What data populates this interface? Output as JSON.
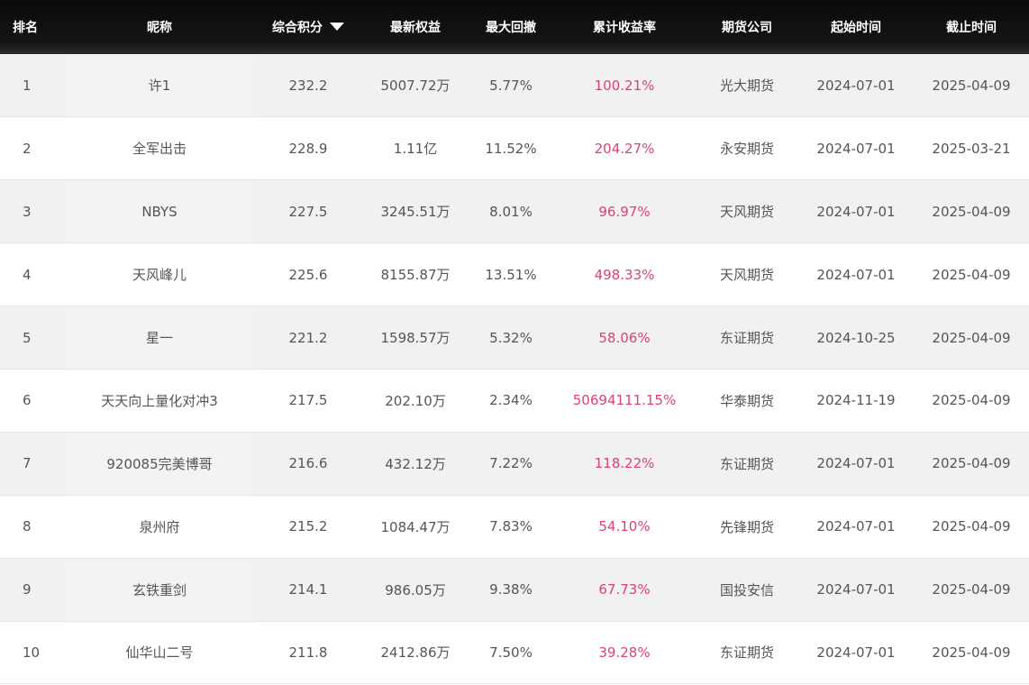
{
  "table": {
    "headers": {
      "rank": "排名",
      "name": "昵称",
      "score": "综合积分",
      "equity": "最新权益",
      "drawdown": "最大回撤",
      "return": "累计收益率",
      "broker": "期货公司",
      "start": "起始时间",
      "end": "截止时间"
    },
    "sort": {
      "column": "score",
      "direction": "desc",
      "icon": "triangle-down-icon"
    },
    "colors": {
      "header_bg": "#111111",
      "return_text": "#dd3f7c",
      "stripe": "#f1f1f1"
    },
    "rows": [
      {
        "rank": "1",
        "name": "许1",
        "score": "232.2",
        "equity": "5007.72万",
        "drawdown": "5.77%",
        "return": "100.21%",
        "broker": "光大期货",
        "start": "2024-07-01",
        "end": "2025-04-09"
      },
      {
        "rank": "2",
        "name": "全军出击",
        "score": "228.9",
        "equity": "1.11亿",
        "drawdown": "11.52%",
        "return": "204.27%",
        "broker": "永安期货",
        "start": "2024-07-01",
        "end": "2025-03-21"
      },
      {
        "rank": "3",
        "name": "NBYS",
        "score": "227.5",
        "equity": "3245.51万",
        "drawdown": "8.01%",
        "return": "96.97%",
        "broker": "天风期货",
        "start": "2024-07-01",
        "end": "2025-04-09"
      },
      {
        "rank": "4",
        "name": "天风峰儿",
        "score": "225.6",
        "equity": "8155.87万",
        "drawdown": "13.51%",
        "return": "498.33%",
        "broker": "天风期货",
        "start": "2024-07-01",
        "end": "2025-04-09"
      },
      {
        "rank": "5",
        "name": "星一",
        "score": "221.2",
        "equity": "1598.57万",
        "drawdown": "5.32%",
        "return": "58.06%",
        "broker": "东证期货",
        "start": "2024-10-25",
        "end": "2025-04-09"
      },
      {
        "rank": "6",
        "name": "天天向上量化对冲3",
        "score": "217.5",
        "equity": "202.10万",
        "drawdown": "2.34%",
        "return": "50694111.15%",
        "broker": "华泰期货",
        "start": "2024-11-19",
        "end": "2025-04-09"
      },
      {
        "rank": "7",
        "name": "920085完美博哥",
        "score": "216.6",
        "equity": "432.12万",
        "drawdown": "7.22%",
        "return": "118.22%",
        "broker": "东证期货",
        "start": "2024-07-01",
        "end": "2025-04-09"
      },
      {
        "rank": "8",
        "name": "泉州府",
        "score": "215.2",
        "equity": "1084.47万",
        "drawdown": "7.83%",
        "return": "54.10%",
        "broker": "先锋期货",
        "start": "2024-07-01",
        "end": "2025-04-09"
      },
      {
        "rank": "9",
        "name": "玄铁重剑",
        "score": "214.1",
        "equity": "986.05万",
        "drawdown": "9.38%",
        "return": "67.73%",
        "broker": "国投安信",
        "start": "2024-07-01",
        "end": "2025-04-09"
      },
      {
        "rank": "10",
        "name": "仙华山二号",
        "score": "211.8",
        "equity": "2412.86万",
        "drawdown": "7.50%",
        "return": "39.28%",
        "broker": "东证期货",
        "start": "2024-07-01",
        "end": "2025-04-09"
      }
    ]
  }
}
